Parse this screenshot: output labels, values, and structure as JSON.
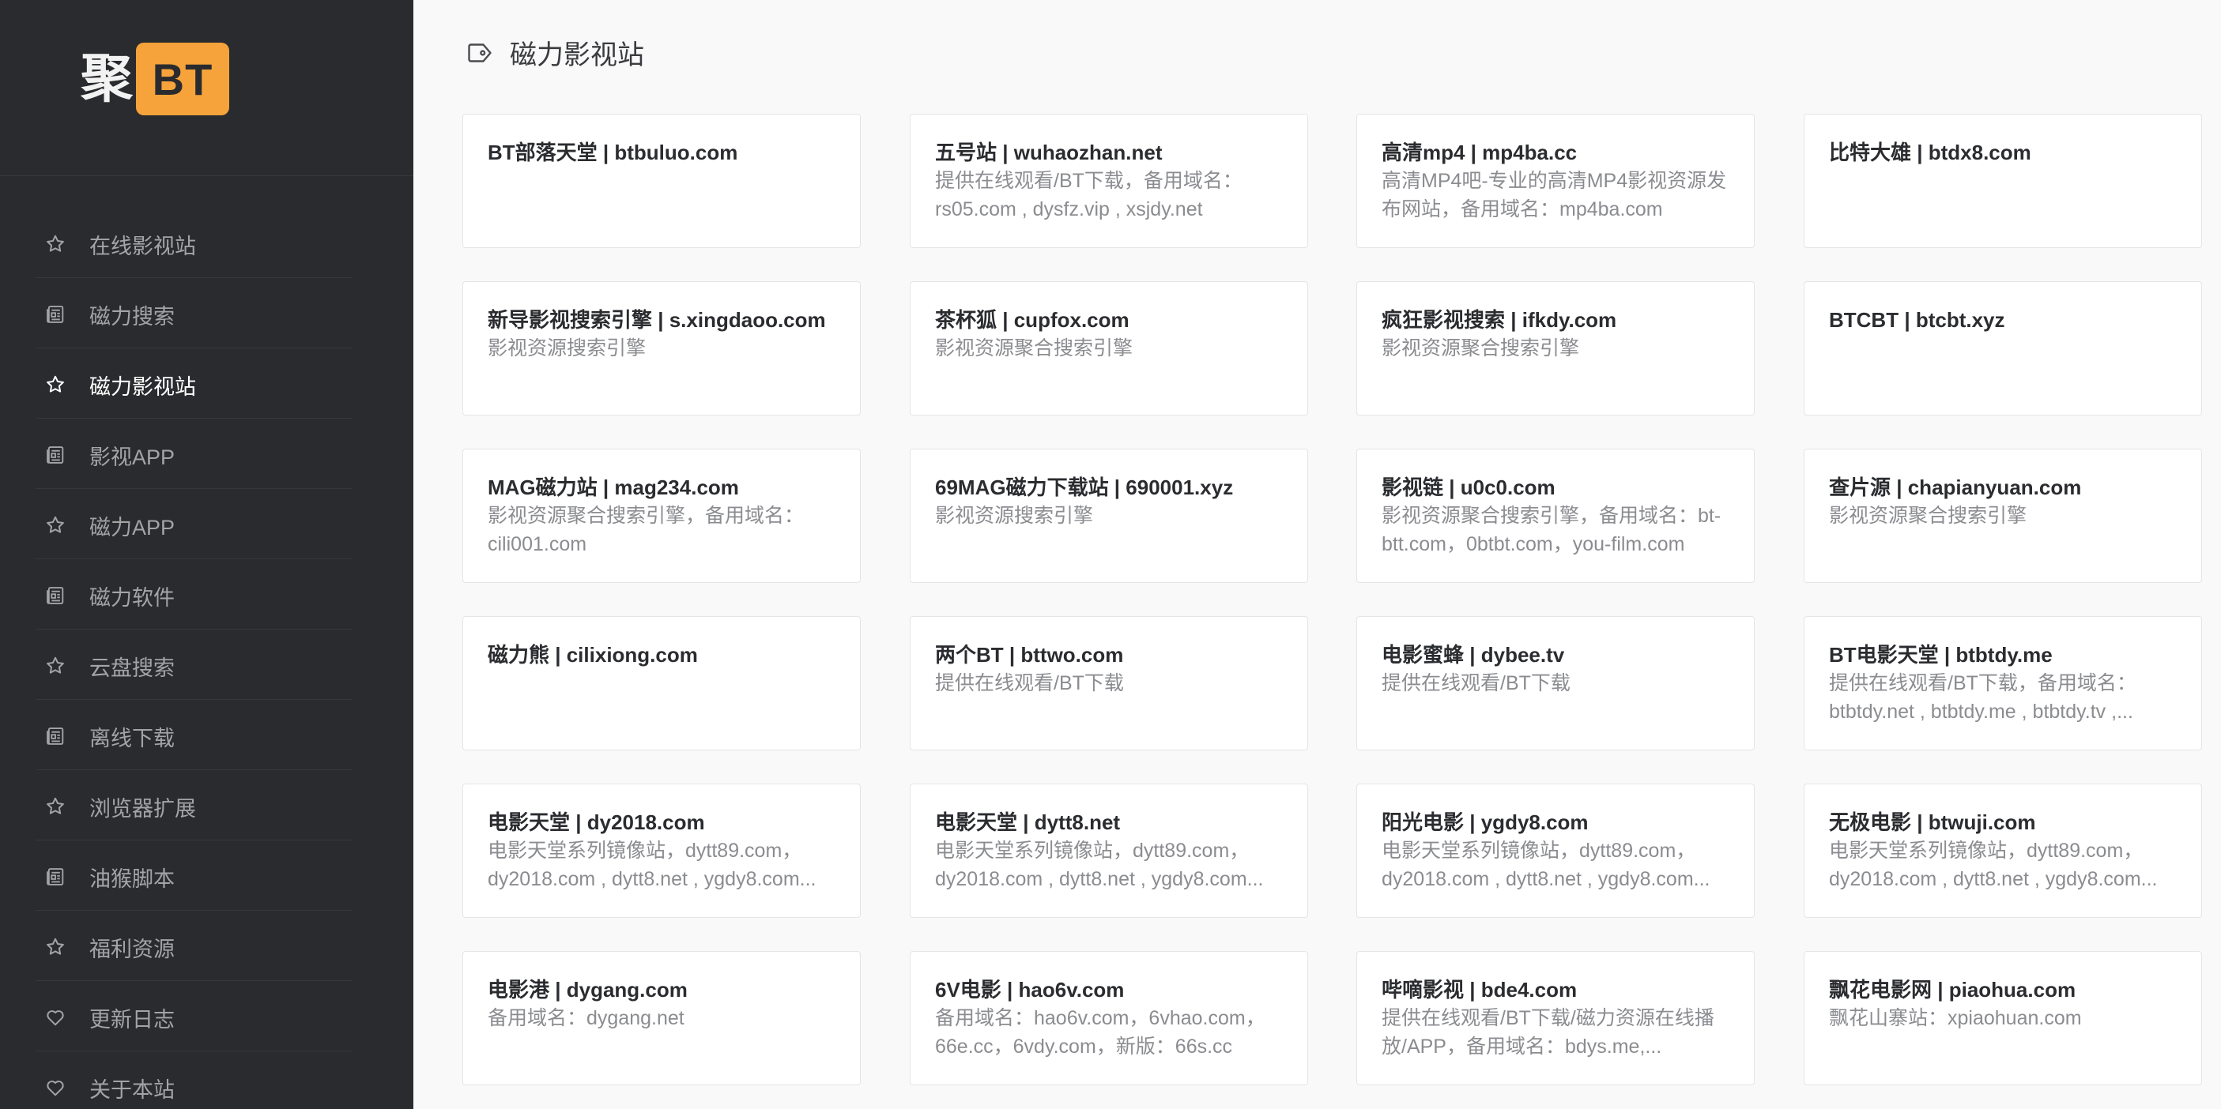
{
  "logo": {
    "char": "聚",
    "badge": "BT"
  },
  "sidebar": {
    "items": [
      {
        "label": "在线影视站",
        "icon": "star-icon",
        "active": false
      },
      {
        "label": "磁力搜索",
        "icon": "news-icon",
        "active": false
      },
      {
        "label": "磁力影视站",
        "icon": "star-icon",
        "active": true
      },
      {
        "label": "影视APP",
        "icon": "news-icon",
        "active": false
      },
      {
        "label": "磁力APP",
        "icon": "star-icon",
        "active": false
      },
      {
        "label": "磁力软件",
        "icon": "news-icon",
        "active": false
      },
      {
        "label": "云盘搜索",
        "icon": "star-icon",
        "active": false
      },
      {
        "label": "离线下载",
        "icon": "news-icon",
        "active": false
      },
      {
        "label": "浏览器扩展",
        "icon": "star-icon",
        "active": false
      },
      {
        "label": "油猴脚本",
        "icon": "news-icon",
        "active": false
      },
      {
        "label": "福利资源",
        "icon": "star-icon",
        "active": false
      },
      {
        "label": "更新日志",
        "icon": "heart-icon",
        "active": false
      },
      {
        "label": "关于本站",
        "icon": "heart-icon",
        "active": false
      }
    ]
  },
  "main": {
    "title": "磁力影视站",
    "title_icon": "tag-icon",
    "cards": [
      {
        "title": "BT部落天堂 | btbuluo.com",
        "desc": ""
      },
      {
        "title": "五号站 | wuhaozhan.net",
        "desc": "提供在线观看/BT下载，备用域名：rs05.com , dysfz.vip , xsjdy.net"
      },
      {
        "title": "高清mp4 | mp4ba.cc",
        "desc": "高清MP4吧-专业的高清MP4影视资源发布网站，备用域名：mp4ba.com"
      },
      {
        "title": "比特大雄 | btdx8.com",
        "desc": ""
      },
      {
        "title": "新导影视搜索引擎 | s.xingdaoo.com",
        "desc": "影视资源搜索引擎"
      },
      {
        "title": "茶杯狐 | cupfox.com",
        "desc": "影视资源聚合搜索引擎"
      },
      {
        "title": "疯狂影视搜索 | ifkdy.com",
        "desc": "影视资源聚合搜索引擎"
      },
      {
        "title": "BTCBT | btcbt.xyz",
        "desc": ""
      },
      {
        "title": "MAG磁力站 | mag234.com",
        "desc": "影视资源聚合搜索引擎，备用域名：cili001.com"
      },
      {
        "title": "69MAG磁力下载站 | 690001.xyz",
        "desc": "影视资源搜索引擎"
      },
      {
        "title": "影视链 | u0c0.com",
        "desc": "影视资源聚合搜索引擎，备用域名：bt-btt.com，0btbt.com，you-film.com"
      },
      {
        "title": "查片源 | chapianyuan.com",
        "desc": "影视资源聚合搜索引擎"
      },
      {
        "title": "磁力熊 | cilixiong.com",
        "desc": ""
      },
      {
        "title": "两个BT | bttwo.com",
        "desc": "提供在线观看/BT下载"
      },
      {
        "title": "电影蜜蜂 | dybee.tv",
        "desc": "提供在线观看/BT下载"
      },
      {
        "title": "BT电影天堂 | btbtdy.me",
        "desc": "提供在线观看/BT下载，备用域名：btbtdy.net , btbtdy.me , btbtdy.tv ,..."
      },
      {
        "title": "电影天堂 | dy2018.com",
        "desc": "电影天堂系列镜像站，dytt89.com，dy2018.com , dytt8.net , ygdy8.com..."
      },
      {
        "title": "电影天堂 | dytt8.net",
        "desc": "电影天堂系列镜像站，dytt89.com，dy2018.com , dytt8.net , ygdy8.com..."
      },
      {
        "title": "阳光电影 | ygdy8.com",
        "desc": "电影天堂系列镜像站，dytt89.com，dy2018.com , dytt8.net , ygdy8.com..."
      },
      {
        "title": "无极电影 | btwuji.com",
        "desc": "电影天堂系列镜像站，dytt89.com，dy2018.com , dytt8.net , ygdy8.com..."
      },
      {
        "title": "电影港 | dygang.com",
        "desc": "备用域名：dygang.net"
      },
      {
        "title": "6V电影 | hao6v.com",
        "desc": "备用域名：hao6v.com，6vhao.com，66e.cc，6vdy.com，新版：66s.cc"
      },
      {
        "title": "哔嘀影视 | bde4.com",
        "desc": "提供在线观看/BT下载/磁力资源在线播放/APP，备用域名：bdys.me,..."
      },
      {
        "title": "飘花电影网 | piaohua.com",
        "desc": "飘花山寨站：xpiaohuan.com"
      }
    ]
  }
}
